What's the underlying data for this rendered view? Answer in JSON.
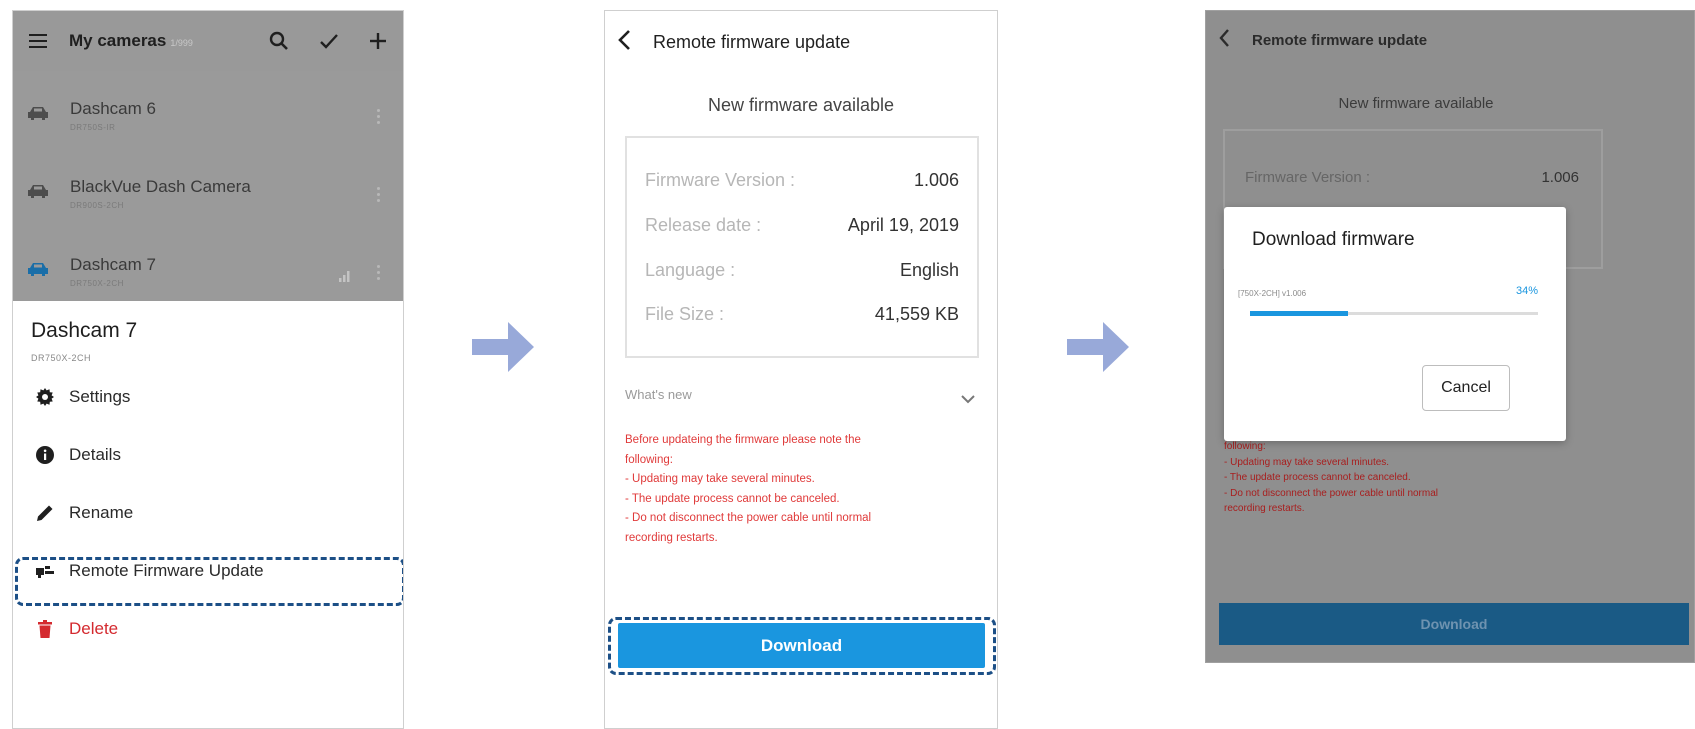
{
  "colors": {
    "accent": "#1a96df",
    "danger": "#d42a2f",
    "highlight_border": "#1c4f86",
    "arrow": "#98a9d9"
  },
  "screen1": {
    "app_title": "My cameras",
    "camera_count": "1/999",
    "header_icons": [
      "menu-icon",
      "search-icon",
      "check-icon",
      "plus-icon"
    ],
    "cameras": [
      {
        "name": "Dashcam 6",
        "model": "DR750S-IR",
        "icon": "car-icon"
      },
      {
        "name": "BlackVue Dash Camera",
        "model": "DR900S-2CH",
        "icon": "car-icon"
      },
      {
        "name": "Dashcam 7",
        "model": "DR750X-2CH",
        "icon": "car-icon",
        "connected": true
      }
    ],
    "sheet": {
      "device_name": "Dashcam 7",
      "device_model": "DR750X-2CH",
      "menu": [
        {
          "label": "Settings",
          "icon": "gear-icon"
        },
        {
          "label": "Details",
          "icon": "info-icon"
        },
        {
          "label": "Rename",
          "icon": "pencil-icon"
        },
        {
          "label": "Remote Firmware Update",
          "icon": "firmware-icon"
        },
        {
          "label": "Delete",
          "icon": "trash-icon"
        }
      ]
    }
  },
  "screen2": {
    "header_title": "Remote firmware update",
    "subtitle": "New firmware available",
    "info": [
      {
        "key": "Firmware Version :",
        "value": "1.006"
      },
      {
        "key": "Release date :",
        "value": "April 19, 2019"
      },
      {
        "key": "Language :",
        "value": "English"
      },
      {
        "key": "File Size :",
        "value": "41,559 KB"
      }
    ],
    "whats_new_label": "What's new",
    "notes": "Before updateing the firmware please note the\nfollowing:\n - Updating may take several minutes.\n - The update process cannot be canceled.\n - Do not disconnect the power cable until normal\nrecording restarts.",
    "download_label": "Download"
  },
  "screen3": {
    "header_title": "Remote firmware update",
    "subtitle": "New firmware available",
    "firmware_key": "Firmware Version :",
    "firmware_value": "1.006",
    "notes": "following:\n - Updating may take several minutes.\n - The update process cannot be canceled.\n - Do not disconnect the power cable until normal\nrecording restarts.",
    "download_label": "Download",
    "dialog": {
      "title": "Download firmware",
      "file_label": "[750X-2CH] v1.006",
      "percent_text": "34%",
      "progress": 0.34,
      "cancel_label": "Cancel"
    }
  }
}
